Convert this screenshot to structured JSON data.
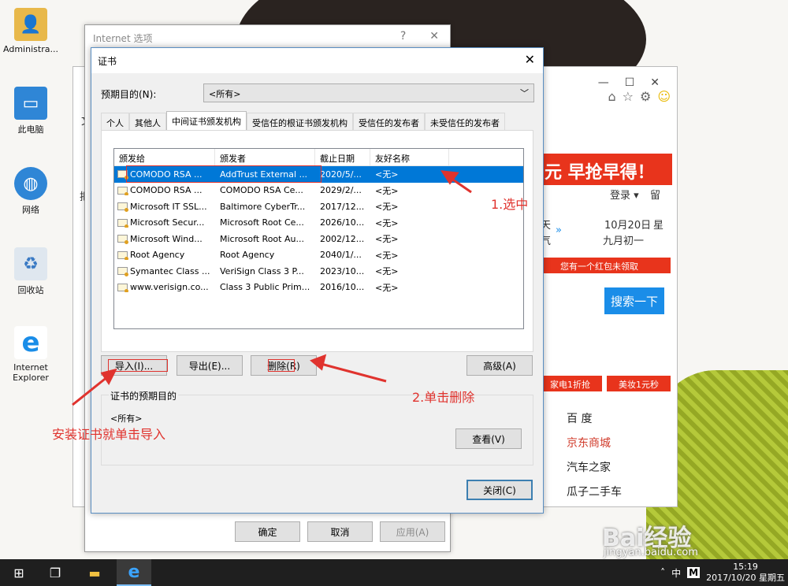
{
  "desktop_icons": [
    {
      "label": "Administra...",
      "icon": "user-folder-icon"
    },
    {
      "label": "此电脑",
      "icon": "computer-icon"
    },
    {
      "label": "网络",
      "icon": "network-icon"
    },
    {
      "label": "回收站",
      "icon": "recycle-bin-icon"
    },
    {
      "label": "Internet Explorer",
      "icon": "ie-icon"
    }
  ],
  "browser": {
    "banner": "元 早抢早得！",
    "login": "登录 ▾",
    "nav_right": "留",
    "date": "10月20日",
    "lunar": "九月初一",
    "weekday_prefix": "星",
    "weather_top": "天",
    "weather_bottom": "气",
    "red_packet": "您有一个红包未领取",
    "search_button": "搜索一下",
    "promo_left": "家电1折抢",
    "promo_right": "美妆1元秒",
    "side_links": [
      "百  度",
      "京东商城",
      "汽车之家",
      "瓜子二手车"
    ],
    "fragments": {
      "wen": "文",
      "ba": "把"
    }
  },
  "internet_options": {
    "title": "Internet 选项",
    "help": "?",
    "close": "✕",
    "ok": "确定",
    "cancel": "取消",
    "apply": "应用(A)"
  },
  "cert_dialog": {
    "title": "证书",
    "close": "✕",
    "purpose_label": "预期目的(N):",
    "purpose_value": "<所有>",
    "tabs": [
      "个人",
      "其他人",
      "中间证书颁发机构",
      "受信任的根证书颁发机构",
      "受信任的发布者",
      "未受信任的发布者"
    ],
    "active_tab": 2,
    "columns": [
      "颁发给",
      "颁发者",
      "截止日期",
      "友好名称"
    ],
    "rows": [
      [
        "COMODO RSA ...",
        "AddTrust External ...",
        "2020/5/...",
        "<无>"
      ],
      [
        "COMODO RSA ...",
        "COMODO RSA Ce...",
        "2029/2/...",
        "<无>"
      ],
      [
        "Microsoft IT SSL...",
        "Baltimore CyberTr...",
        "2017/12...",
        "<无>"
      ],
      [
        "Microsoft Secur...",
        "Microsoft Root Ce...",
        "2026/10...",
        "<无>"
      ],
      [
        "Microsoft Wind...",
        "Microsoft Root Au...",
        "2002/12...",
        "<无>"
      ],
      [
        "Root Agency",
        "Root Agency",
        "2040/1/...",
        "<无>"
      ],
      [
        "Symantec Class ...",
        "VeriSign Class 3 P...",
        "2023/10...",
        "<无>"
      ],
      [
        "www.verisign.co...",
        "Class 3 Public Prim...",
        "2016/10...",
        "<无>"
      ]
    ],
    "selected_row": 0,
    "import": "导入(I)...",
    "export": "导出(E)...",
    "remove": "删除(R)",
    "advanced": "高级(A)",
    "purposes_group": "证书的预期目的",
    "purposes_value": "<所有>",
    "view": "查看(V)",
    "close_button": "关闭(C)"
  },
  "annotations": {
    "step1": "1.选中",
    "step2": "2.单击删除",
    "tip": "安装证书就单击导入"
  },
  "taskbar": {
    "ime": "中",
    "m": "M",
    "time": "15:19",
    "date": "2017/10/20 星期五"
  },
  "watermark": {
    "logo": "Bai经验",
    "url": "jingyan.baidu.com"
  },
  "colors": {
    "selection": "#0078d7",
    "annotation": "#e0332e",
    "accent_red": "#e8341c",
    "search_blue": "#1a8de8"
  }
}
